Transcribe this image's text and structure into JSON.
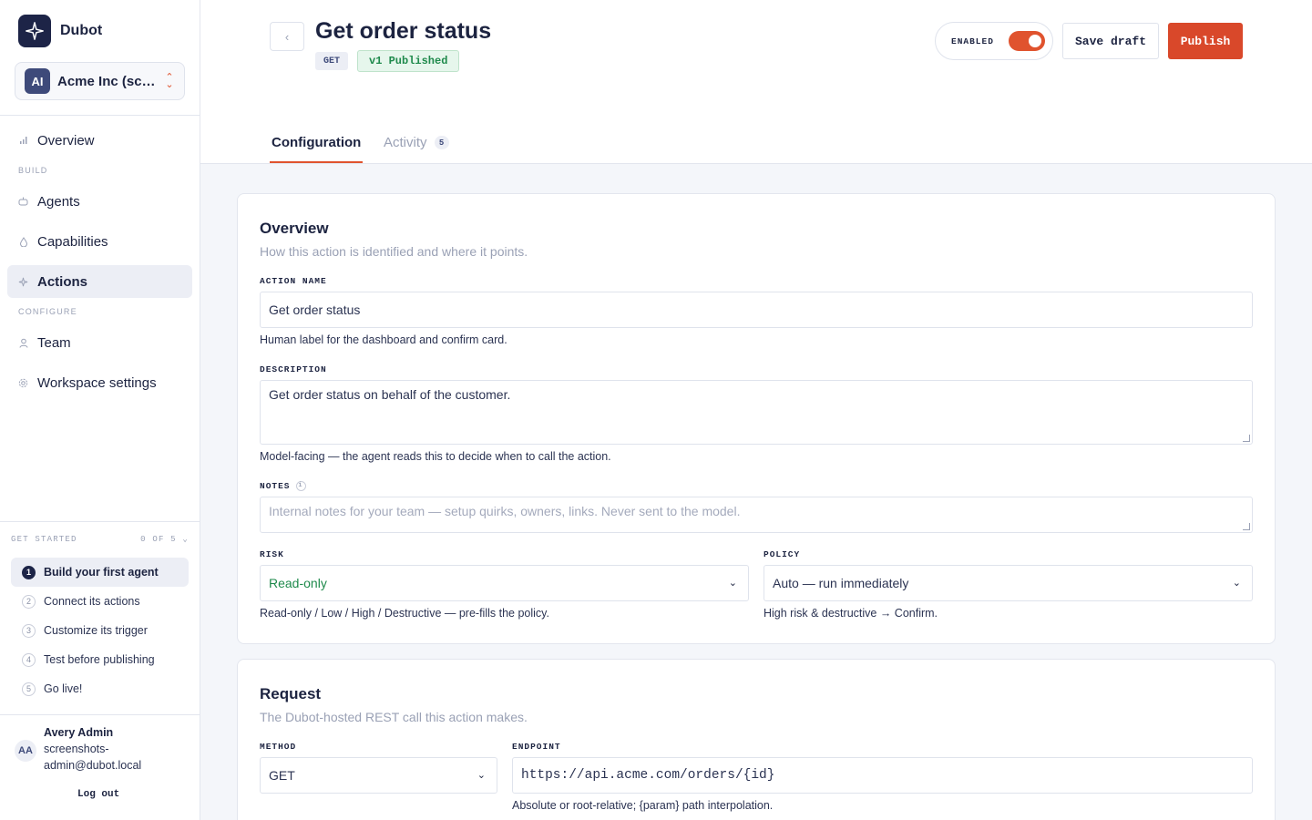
{
  "brand": {
    "name": "Dubot"
  },
  "workspace": {
    "avatar": "AI",
    "name": "Acme Inc (scr..."
  },
  "nav": {
    "overview": "Overview",
    "section_build": "BUILD",
    "agents": "Agents",
    "capabilities": "Capabilities",
    "actions": "Actions",
    "section_configure": "CONFIGURE",
    "team": "Team",
    "workspace_settings": "Workspace settings"
  },
  "get_started": {
    "title": "GET STARTED",
    "progress": "0 OF 5",
    "steps": [
      {
        "num": "1",
        "label": "Build your first agent"
      },
      {
        "num": "2",
        "label": "Connect its actions"
      },
      {
        "num": "3",
        "label": "Customize its trigger"
      },
      {
        "num": "4",
        "label": "Test before publishing"
      },
      {
        "num": "5",
        "label": "Go live!"
      }
    ]
  },
  "user": {
    "initials": "AA",
    "name": "Avery Admin",
    "email": "screenshots-admin@dubot.local",
    "logout": "Log out"
  },
  "header": {
    "title": "Get order status",
    "method_badge": "GET",
    "version_badge": "v1 Published",
    "enabled_label": "ENABLED",
    "enabled": true,
    "save_draft": "Save draft",
    "publish": "Publish"
  },
  "tabs": [
    {
      "label": "Configuration",
      "active": true
    },
    {
      "label": "Activity",
      "count": "5"
    }
  ],
  "overview": {
    "title": "Overview",
    "subtitle": "How this action is identified and where it points.",
    "action_name_label": "ACTION NAME",
    "action_name_value": "Get order status",
    "action_name_help": "Human label for the dashboard and confirm card.",
    "description_label": "DESCRIPTION",
    "description_value": "Get order status on behalf of the customer.",
    "description_help": "Model-facing — the agent reads this to decide when to call the action.",
    "notes_label": "NOTES",
    "notes_placeholder": "Internal notes for your team — setup quirks, owners, links. Never sent to the model.",
    "risk_label": "RISK",
    "risk_value": "Read-only",
    "risk_help": "Read-only / Low / High / Destructive — pre-fills the policy.",
    "policy_label": "POLICY",
    "policy_value": "Auto — run immediately",
    "policy_help": "High risk & destructive → Confirm."
  },
  "request": {
    "title": "Request",
    "subtitle": "The Dubot-hosted REST call this action makes.",
    "method_label": "METHOD",
    "method_value": "GET",
    "endpoint_label": "ENDPOINT",
    "endpoint_value": "https://api.acme.com/orders/{id}",
    "endpoint_help": "Absolute or root-relative; {param} path interpolation."
  },
  "colors": {
    "accent": "#e0532e",
    "brand": "#1d2447",
    "success": "#1f8a4c"
  }
}
